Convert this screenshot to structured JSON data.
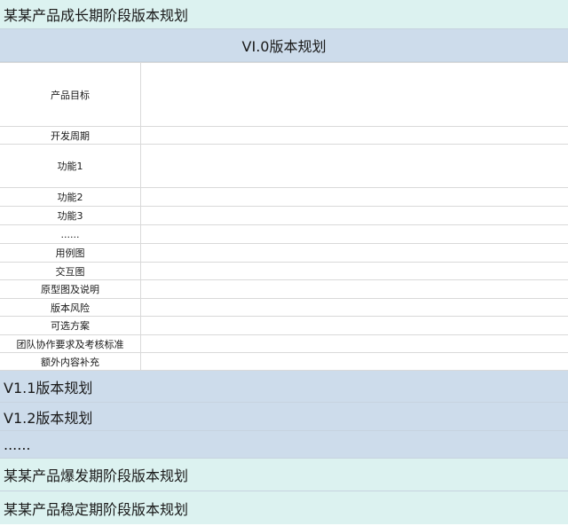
{
  "sections": {
    "growth_title": "某某产品成长期阶段版本规划",
    "v10_title": "VI.0版本规划",
    "v11_title": "V1.1版本规划",
    "v12_title": "V1.2版本规划",
    "more_title": "......",
    "burst_title": "某某产品爆发期阶段版本规划",
    "stable_title": "某某产品稳定期阶段版本规划"
  },
  "v10_rows": [
    {
      "label": "产品目标",
      "value": ""
    },
    {
      "label": "开发周期",
      "value": ""
    },
    {
      "label": "功能1",
      "value": ""
    },
    {
      "label": "功能2",
      "value": ""
    },
    {
      "label": "功能3",
      "value": ""
    },
    {
      "label": "......",
      "value": ""
    },
    {
      "label": "用例图",
      "value": ""
    },
    {
      "label": "交互图",
      "value": ""
    },
    {
      "label": "原型图及说明",
      "value": ""
    },
    {
      "label": "版本风险",
      "value": ""
    },
    {
      "label": "可选方案",
      "value": ""
    },
    {
      "label": "团队协作要求及考核标准",
      "value": ""
    },
    {
      "label": "额外内容补充",
      "value": ""
    }
  ]
}
